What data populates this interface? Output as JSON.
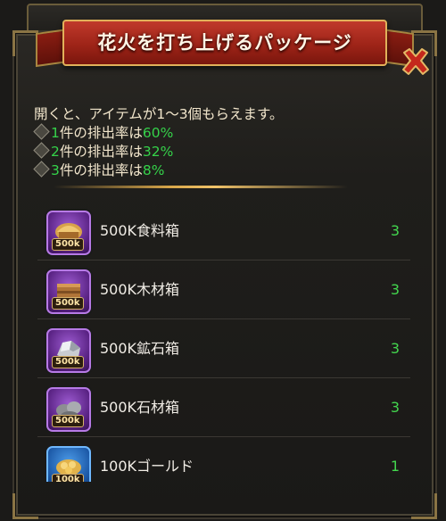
{
  "title": "花火を打ち上げるパッケージ",
  "description": {
    "intro": "開くと、アイテムが1〜3個もらえます。",
    "rates": [
      {
        "count": "1",
        "suffix": "件の排出率は",
        "rate": "60%"
      },
      {
        "count": "2",
        "suffix": "件の排出率は",
        "rate": "32%"
      },
      {
        "count": "3",
        "suffix": "件の排出率は",
        "rate": "8%"
      }
    ]
  },
  "items": [
    {
      "name": "500K食料箱",
      "qty": "3",
      "badge": "500k",
      "icon": "food-crate-icon",
      "frame": "purple"
    },
    {
      "name": "500K木材箱",
      "qty": "3",
      "badge": "500k",
      "icon": "wood-crate-icon",
      "frame": "purple"
    },
    {
      "name": "500K鉱石箱",
      "qty": "3",
      "badge": "500k",
      "icon": "ore-crate-icon",
      "frame": "purple"
    },
    {
      "name": "500K石材箱",
      "qty": "3",
      "badge": "500k",
      "icon": "stone-crate-icon",
      "frame": "purple"
    },
    {
      "name": "100Kゴールド",
      "qty": "1",
      "badge": "100k",
      "icon": "gold-crate-icon",
      "frame": "blue"
    }
  ],
  "colors": {
    "ribbon": "#9e2418",
    "highlight": "#35d24a",
    "quantity": "#43d64e",
    "frame_gold": "#d9a74a"
  }
}
